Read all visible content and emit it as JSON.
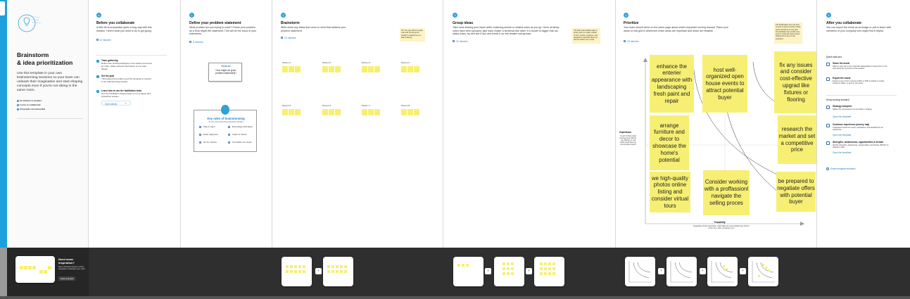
{
  "intro": {
    "title_line1": "Brainstorm",
    "title_line2": "& idea prioritization",
    "desc": "Use this template in your own brainstorming sessions so your team can unleash their imagination and start shaping concepts even if you're not sitting in the same room.",
    "meta": [
      "10 minutes to prepare",
      "1 hour to collaborate",
      "2-8 people recommended"
    ],
    "promo_title": "Need some inspiration?",
    "promo_desc": "See a finished version of this template to kickstart your work.",
    "promo_button": "Open example"
  },
  "step1": {
    "num": "A",
    "title": "Before you collaborate",
    "desc": "A little bit of preparation goes a long way with this session. Here's what you need to do to get going.",
    "timer": "10 minutes",
    "items": [
      {
        "title": "Team gathering",
        "desc": "Define who should participate in the session and send an invite. Share relevant information or pre-work ahead."
      },
      {
        "title": "Set the goal",
        "desc": "Think about the problem you'll be focusing on solving in the brainstorming session."
      },
      {
        "title": "Learn how to use the facilitation tools",
        "desc": "Use the Facilitation Superpowers to run a happy and productive session."
      }
    ],
    "open_link": "Open article"
  },
  "step2": {
    "num": "1",
    "title": "Define your problem statement",
    "desc": "What problem are you trying to solve? Frame your problem as a How Might We statement. This will be the focus of your brainstorm.",
    "timer": "5 minutes",
    "card_label": "PROBLEM",
    "card_text": "How might we [your problem statement]?",
    "rules_title": "Key rules of brainstorming",
    "rules_sub": "To run a smooth and productive session",
    "rules": [
      "Stay in topic.",
      "Encourage wild ideas.",
      "Defer judgment.",
      "Listen to others.",
      "Go for volume.",
      "If possible, be visual."
    ]
  },
  "step3": {
    "num": "2",
    "title": "Brainstorm",
    "desc": "Write down any ideas that come to mind that address your problem statement.",
    "timer": "10 minutes",
    "note": "TIP You can select a sticky note and hit the pencil [switch to sketch] icon to start drawing!",
    "persons": [
      "Person 1",
      "Person 2",
      "Person 3",
      "Person 4",
      "Person 5",
      "Person 6",
      "Person 7",
      "Person 8"
    ]
  },
  "step4": {
    "num": "3",
    "title": "Group ideas",
    "desc": "Take turns sharing your ideas while clustering similar or related notes as you go. Once all sticky notes have been grouped, give each cluster a sentence-like label. If a cluster is bigger than six sticky notes, try and see if you and break it up into smaller sub-groups.",
    "timer": "20 minutes",
    "note": "TIP Add customizable tags to sticky notes to make it easier to find, browse, organize, and categorize important ideas as themes within your mural."
  },
  "step5": {
    "num": "4",
    "title": "Prioritize",
    "desc": "Your team should all be on the same page about what's important moving forward. Place your ideas on this grid to determine which ideas are important and which are feasible.",
    "timer": "20 minutes",
    "note": "TIP Participants can use their cursors to point at where sticky notes should go on the grid. The facilitator can confirm the spot by using the laser pointer holding the H key on the keyboard.",
    "y_label": "Importance",
    "y_desc": "If each of these tasks could get done without any difficulty or cost, which would have the most positive impact?",
    "x_label": "Feasibility",
    "x_desc": "Regardless of their importance, which tasks are more feasible than others? (Cost, time, effort, complexity, etc.)",
    "stickies": [
      "enhance the enterier appearance with landscaping fresh paint and repair",
      "host well-organized open house events to attract potential buyer",
      "fix any issues and consider cost-effective upgrad like fixtures or flooring",
      "arrange furniture and decor to showcase the home's potential",
      "research the market and set a competitive price",
      "we high-quality photos online listing and consider virtual tours",
      "Consider working with a proffassionl navigate the selling proces",
      "be prepared to negatiate offers with potential buyer"
    ]
  },
  "step6": {
    "num": "5",
    "title": "After you collaborate",
    "desc": "You can export the mural as an image or pdf to share with members of your company who might find it helpful.",
    "quick_title": "Quick add-ons",
    "quick": [
      {
        "title": "Share the mural",
        "desc": "Share a view link to the mural with stakeholders to keep them in the loop about the outcomes of the session."
      },
      {
        "title": "Export the mural",
        "desc": "Export a copy of the mural as a PNG or PDF to attach to emails, include in slides, or save in your drive."
      }
    ],
    "keep_title": "Keep moving forward",
    "keep": [
      {
        "title": "Strategy blueprint",
        "desc": "Define the components of a new idea or strategy.",
        "link": "Open the template"
      },
      {
        "title": "Customer experience journey map",
        "desc": "Understand customer needs, motivations, and obstacles for an experience.",
        "link": "Open the template"
      },
      {
        "title": "Strengths, weaknesses, opportunities & threats",
        "desc": "Identify strengths, weaknesses, opportunities, and threats (SWOT) to develop a plan.",
        "link": "Open the template"
      }
    ],
    "feedback": "Share template feedback"
  },
  "colors": {
    "accent": "#2ea1d8",
    "sticky": "#f7ef73",
    "strip": "#2f2f2f",
    "sidebar": "#1ea0dc"
  }
}
